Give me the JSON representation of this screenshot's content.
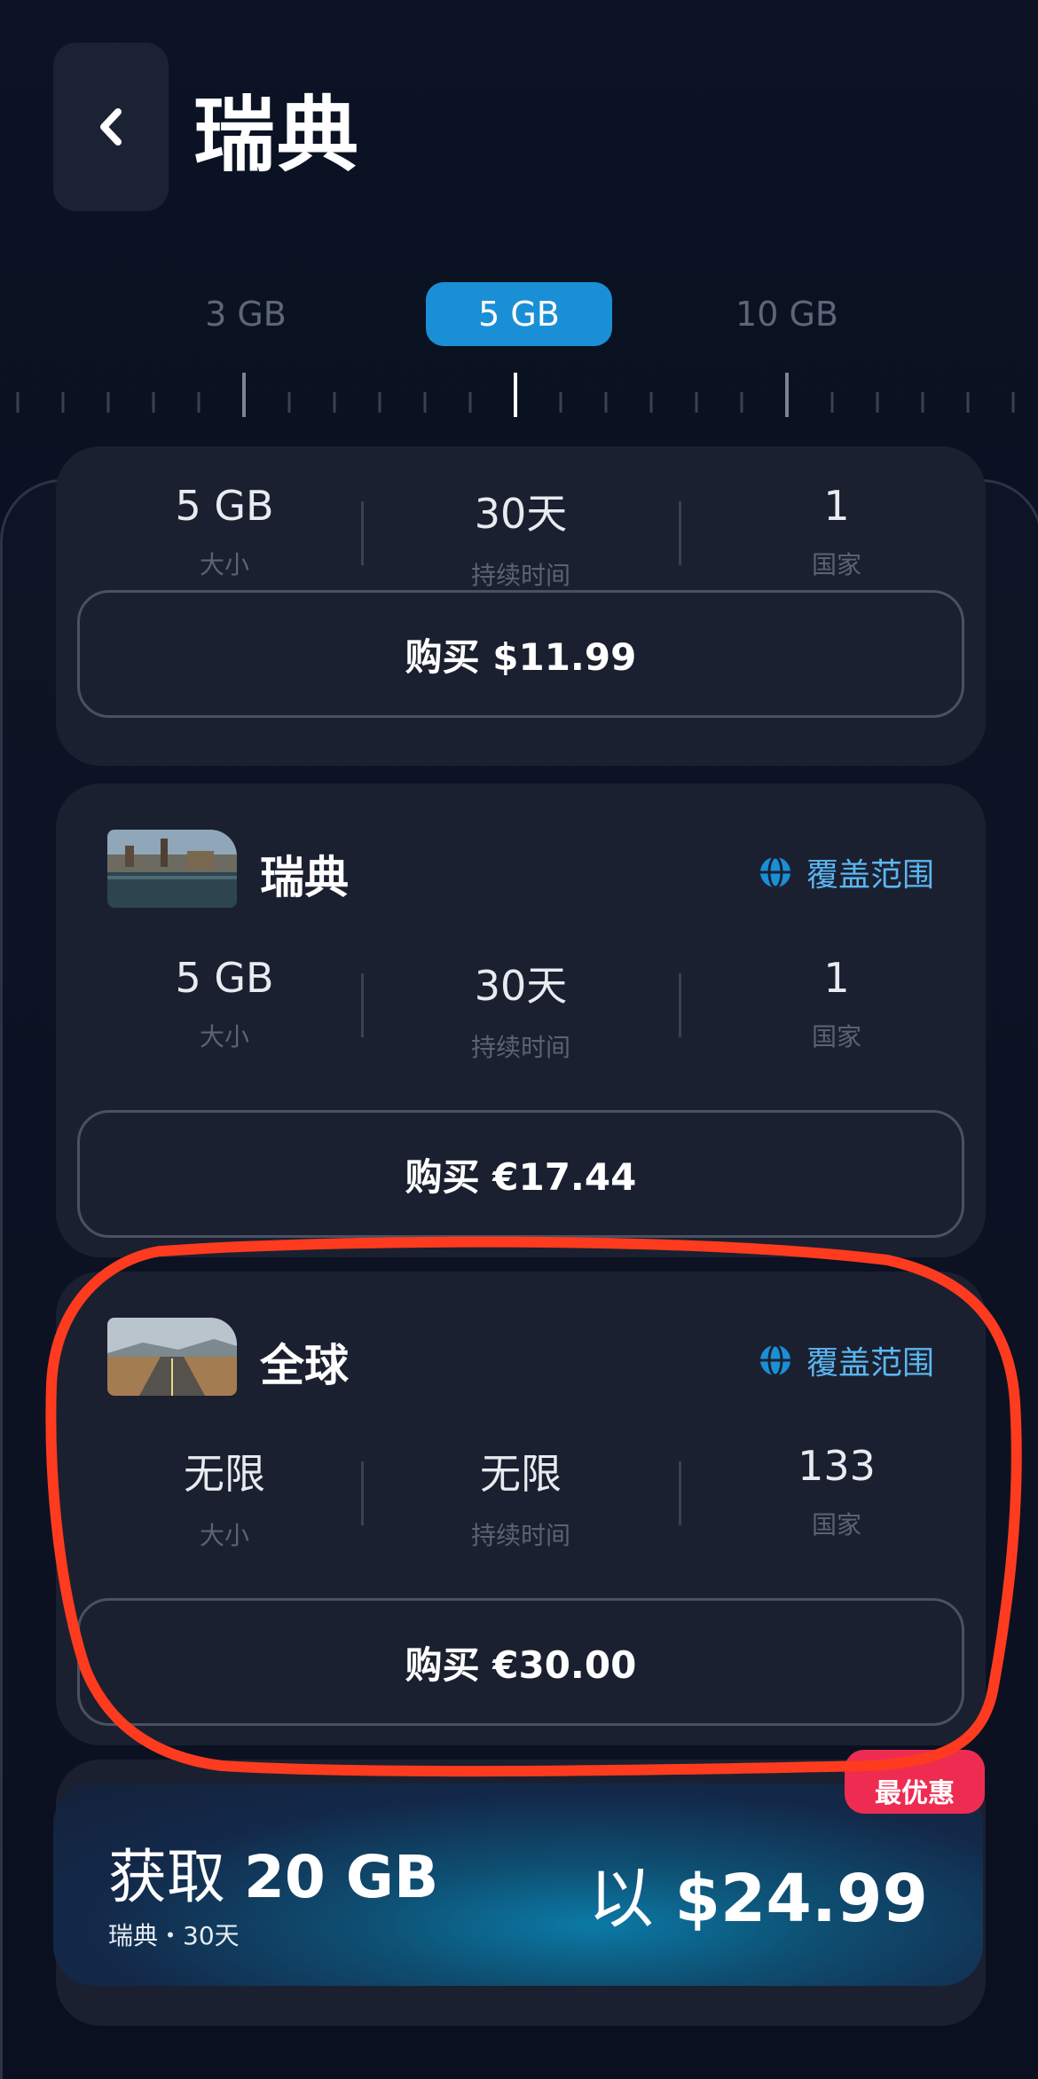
{
  "header": {
    "title": "瑞典"
  },
  "plans": {
    "tabs": [
      "3 GB",
      "5 GB",
      "10 GB"
    ],
    "selected_index": 1
  },
  "labels": {
    "size": "大小",
    "duration": "持续时间",
    "countries": "国家",
    "coverage": "覆盖范围"
  },
  "cards": [
    {
      "name": "",
      "size": "5 GB",
      "duration": "30天",
      "countries": "1",
      "buy": "购买 $11.99"
    },
    {
      "name": "瑞典",
      "size": "5 GB",
      "duration": "30天",
      "countries": "1",
      "buy": "购买 €17.44"
    },
    {
      "name": "全球",
      "size": "无限",
      "duration": "无限",
      "countries": "133",
      "buy": "购买 €30.00"
    }
  ],
  "promo": {
    "badge": "最优惠",
    "prefix": "获取",
    "amount": "20 GB",
    "subtitle": "瑞典・30天",
    "price_prefix": "以",
    "price": "$24.99"
  },
  "colors": {
    "accent": "#1a8fd6",
    "link": "#5ab6f0",
    "annotation": "#ff3b1f",
    "badge": "#ee2c52"
  }
}
